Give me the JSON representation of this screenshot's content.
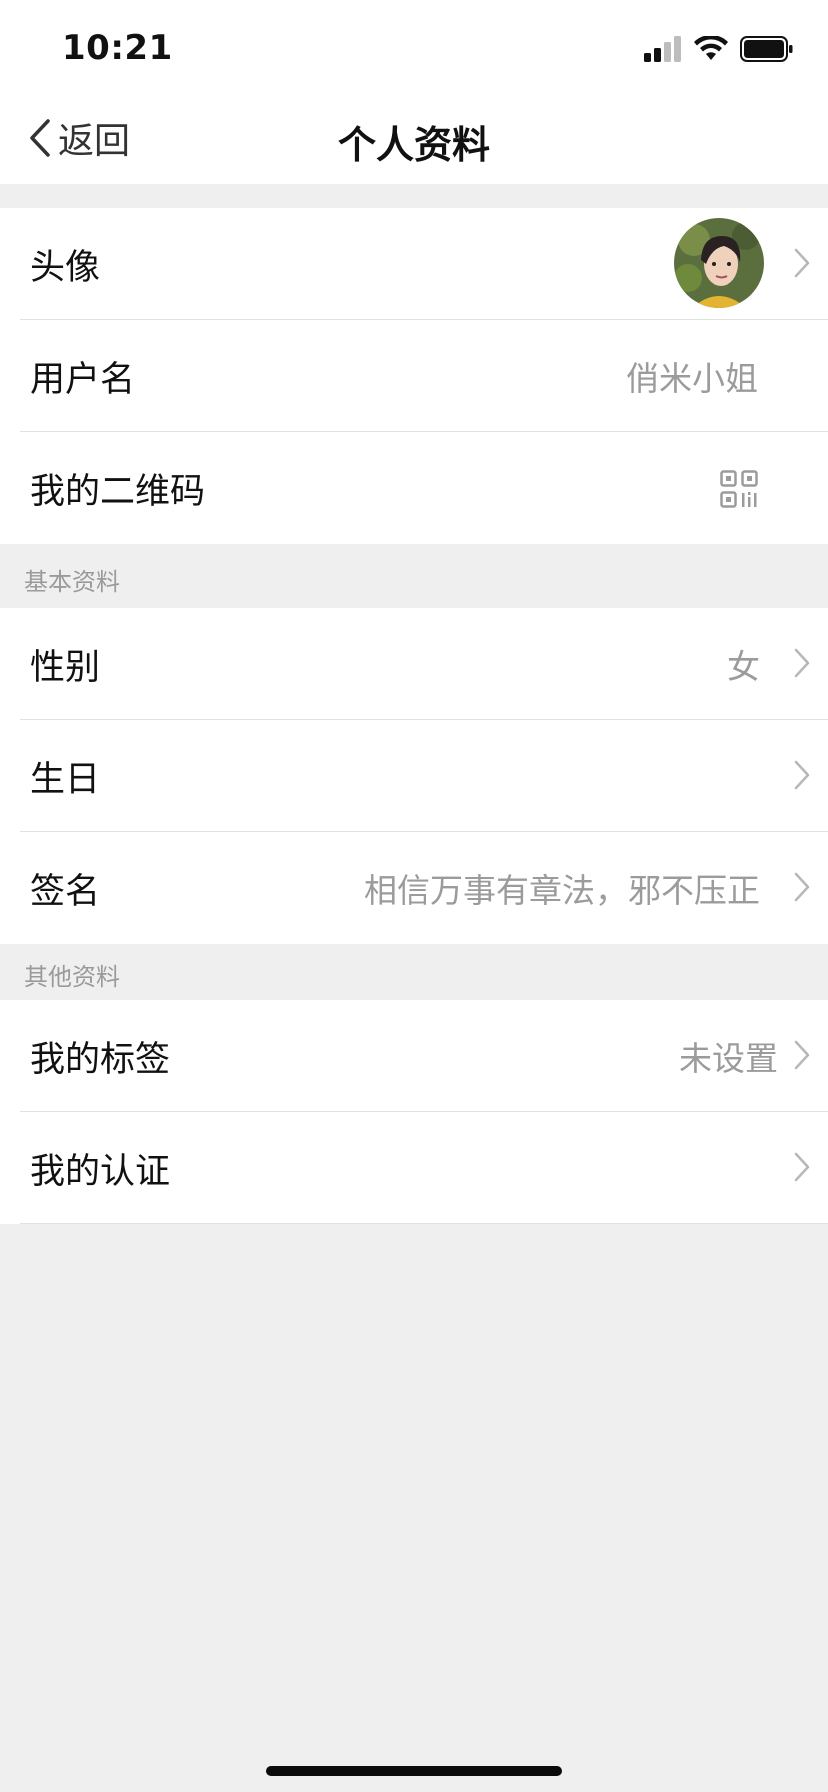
{
  "status_bar": {
    "time": "10:21",
    "icons": [
      "cellular-signal-icon",
      "wifi-icon",
      "battery-icon"
    ]
  },
  "nav": {
    "back_label": "返回",
    "title": "个人资料"
  },
  "profile_group": {
    "avatar_label": "头像",
    "username_label": "用户名",
    "username_value": "俏米小姐",
    "qrcode_label": "我的二维码"
  },
  "basic_section": {
    "header": "基本资料",
    "gender_label": "性别",
    "gender_value": "女",
    "birthday_label": "生日",
    "signature_label": "签名",
    "signature_value": "相信万事有章法，邪不压正"
  },
  "other_section": {
    "header": "其他资料",
    "tags_label": "我的标签",
    "tags_value": "未设置",
    "cert_label": "我的认证"
  },
  "colors": {
    "background": "#efefef",
    "card": "#ffffff",
    "value_text": "#9b9b9b",
    "chevron": "#b7b7b7"
  }
}
